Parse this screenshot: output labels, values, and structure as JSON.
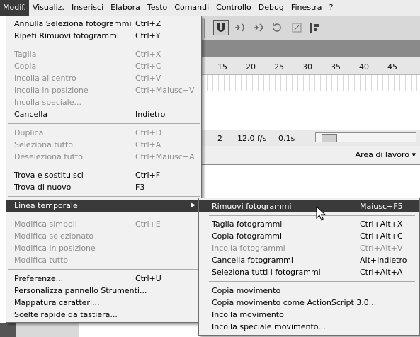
{
  "menubar": {
    "items": [
      "Modif.",
      "Visualiz.",
      "Inserisci",
      "Elabora",
      "Testo",
      "Comandi",
      "Controllo",
      "Debug",
      "Finestra",
      "?"
    ]
  },
  "ruler": {
    "numbers": [
      "15",
      "20",
      "25",
      "30",
      "35",
      "40",
      "45"
    ]
  },
  "status": {
    "frame": "2",
    "fps": "12.0 f/s",
    "time": "0.1s"
  },
  "workspace": {
    "label": "Area di lavoro ▾"
  },
  "main_menu": {
    "items": [
      {
        "label": "Annulla Seleziona fotogrammi",
        "shortcut": "Ctrl+Z",
        "disabled": false
      },
      {
        "label": "Ripeti Rimuovi fotogrammi",
        "shortcut": "Ctrl+Y",
        "disabled": false
      },
      {
        "label": "Taglia",
        "shortcut": "Ctrl+X",
        "disabled": true
      },
      {
        "label": "Copia",
        "shortcut": "Ctrl+C",
        "disabled": true
      },
      {
        "label": "Incolla al centro",
        "shortcut": "Ctrl+V",
        "disabled": true
      },
      {
        "label": "Incolla in posizione",
        "shortcut": "Ctrl+Maiusc+V",
        "disabled": true
      },
      {
        "label": "Incolla speciale...",
        "shortcut": "",
        "disabled": true
      },
      {
        "label": "Cancella",
        "shortcut": "Indietro",
        "disabled": false
      },
      {
        "label": "Duplica",
        "shortcut": "Ctrl+D",
        "disabled": true
      },
      {
        "label": "Seleziona tutto",
        "shortcut": "Ctrl+A",
        "disabled": true
      },
      {
        "label": "Deseleziona tutto",
        "shortcut": "Ctrl+Maiusc+A",
        "disabled": true
      },
      {
        "label": "Trova e sostituisci",
        "shortcut": "Ctrl+F",
        "disabled": false
      },
      {
        "label": "Trova di nuovo",
        "shortcut": "F3",
        "disabled": false
      },
      {
        "label": "Linea temporale",
        "shortcut": "",
        "disabled": false
      },
      {
        "label": "Modifica simboli",
        "shortcut": "Ctrl+E",
        "disabled": true
      },
      {
        "label": "Modifica selezionato",
        "shortcut": "",
        "disabled": true
      },
      {
        "label": "Modifica in posizione",
        "shortcut": "",
        "disabled": true
      },
      {
        "label": "Modifica tutto",
        "shortcut": "",
        "disabled": true
      },
      {
        "label": "Preferenze...",
        "shortcut": "Ctrl+U",
        "disabled": false
      },
      {
        "label": "Personalizza pannello Strumenti...",
        "shortcut": "",
        "disabled": false
      },
      {
        "label": "Mappatura caratteri...",
        "shortcut": "",
        "disabled": false
      },
      {
        "label": "Scelte rapide da tastiera...",
        "shortcut": "",
        "disabled": false
      }
    ]
  },
  "sub_menu": {
    "items": [
      {
        "label": "Rimuovi fotogrammi",
        "shortcut": "Maiusc+F5",
        "disabled": false
      },
      {
        "label": "Taglia fotogrammi",
        "shortcut": "Ctrl+Alt+X",
        "disabled": false
      },
      {
        "label": "Copia fotogrammi",
        "shortcut": "Ctrl+Alt+C",
        "disabled": false
      },
      {
        "label": "Incolla fotogrammi",
        "shortcut": "Ctrl+Alt+V",
        "disabled": true
      },
      {
        "label": "Cancella fotogrammi",
        "shortcut": "Alt+Indietro",
        "disabled": false
      },
      {
        "label": "Seleziona tutti i fotogrammi",
        "shortcut": "Ctrl+Alt+A",
        "disabled": false
      },
      {
        "label": "Copia movimento",
        "shortcut": "",
        "disabled": false
      },
      {
        "label": "Copia movimento come ActionScript 3.0...",
        "shortcut": "",
        "disabled": false
      },
      {
        "label": "Incolla movimento",
        "shortcut": "",
        "disabled": false
      },
      {
        "label": "Incolla speciale movimento...",
        "shortcut": "",
        "disabled": false
      }
    ]
  },
  "icons": [
    "magnet-icon",
    "smooth-icon",
    "straighten-icon",
    "rotate-icon",
    "scale-icon",
    "align-icon"
  ]
}
